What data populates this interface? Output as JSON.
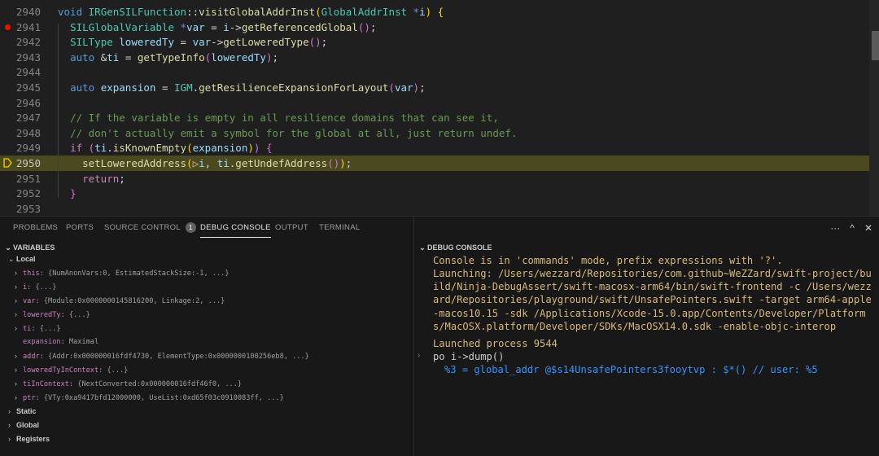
{
  "editor": {
    "lines": [
      {
        "n": "2940",
        "tokens": [
          {
            "c": "kw",
            "t": "void"
          },
          {
            "c": "op",
            "t": " "
          },
          {
            "c": "ty",
            "t": "IRGenSILFunction"
          },
          {
            "c": "op",
            "t": "::"
          },
          {
            "c": "fn",
            "t": "visitGlobalAddrInst"
          },
          {
            "c": "pn",
            "t": "("
          },
          {
            "c": "ty",
            "t": "GlobalAddrInst"
          },
          {
            "c": "op",
            "t": " "
          },
          {
            "c": "kw",
            "t": "*"
          },
          {
            "c": "var",
            "t": "i"
          },
          {
            "c": "pn",
            "t": ")"
          },
          {
            "c": "op",
            "t": " "
          },
          {
            "c": "pn",
            "t": "{"
          }
        ]
      },
      {
        "n": "2941",
        "bp": true,
        "tokens": [
          {
            "c": "op",
            "t": "  "
          },
          {
            "c": "ty",
            "t": "SILGlobalVariable"
          },
          {
            "c": "op",
            "t": " "
          },
          {
            "c": "kw",
            "t": "*"
          },
          {
            "c": "var",
            "t": "var"
          },
          {
            "c": "op",
            "t": " = "
          },
          {
            "c": "var",
            "t": "i"
          },
          {
            "c": "op",
            "t": "->"
          },
          {
            "c": "fn",
            "t": "getReferencedGlobal"
          },
          {
            "c": "pn2",
            "t": "()"
          },
          {
            "c": "op",
            "t": ";"
          }
        ]
      },
      {
        "n": "2942",
        "tokens": [
          {
            "c": "op",
            "t": "  "
          },
          {
            "c": "ty",
            "t": "SILType"
          },
          {
            "c": "op",
            "t": " "
          },
          {
            "c": "var",
            "t": "loweredTy"
          },
          {
            "c": "op",
            "t": " = "
          },
          {
            "c": "var",
            "t": "var"
          },
          {
            "c": "op",
            "t": "->"
          },
          {
            "c": "fn",
            "t": "getLoweredType"
          },
          {
            "c": "pn2",
            "t": "()"
          },
          {
            "c": "op",
            "t": ";"
          }
        ]
      },
      {
        "n": "2943",
        "tokens": [
          {
            "c": "op",
            "t": "  "
          },
          {
            "c": "kw",
            "t": "auto"
          },
          {
            "c": "op",
            "t": " &"
          },
          {
            "c": "var",
            "t": "ti"
          },
          {
            "c": "op",
            "t": " = "
          },
          {
            "c": "fn",
            "t": "getTypeInfo"
          },
          {
            "c": "pn2",
            "t": "("
          },
          {
            "c": "var",
            "t": "loweredTy"
          },
          {
            "c": "pn2",
            "t": ")"
          },
          {
            "c": "op",
            "t": ";"
          }
        ]
      },
      {
        "n": "2944",
        "tokens": []
      },
      {
        "n": "2945",
        "tokens": [
          {
            "c": "op",
            "t": "  "
          },
          {
            "c": "kw",
            "t": "auto"
          },
          {
            "c": "op",
            "t": " "
          },
          {
            "c": "var",
            "t": "expansion"
          },
          {
            "c": "op",
            "t": " = "
          },
          {
            "c": "ty",
            "t": "IGM"
          },
          {
            "c": "op",
            "t": "."
          },
          {
            "c": "fn",
            "t": "getResilienceExpansionForLayout"
          },
          {
            "c": "pn2",
            "t": "("
          },
          {
            "c": "var",
            "t": "var"
          },
          {
            "c": "pn2",
            "t": ")"
          },
          {
            "c": "op",
            "t": ";"
          }
        ]
      },
      {
        "n": "2946",
        "tokens": []
      },
      {
        "n": "2947",
        "tokens": [
          {
            "c": "op",
            "t": "  "
          },
          {
            "c": "cm",
            "t": "// If the variable is empty in all resilience domains that can see it,"
          }
        ]
      },
      {
        "n": "2948",
        "tokens": [
          {
            "c": "op",
            "t": "  "
          },
          {
            "c": "cm",
            "t": "// don't actually emit a symbol for the global at all, just return undef."
          }
        ]
      },
      {
        "n": "2949",
        "tokens": [
          {
            "c": "op",
            "t": "  "
          },
          {
            "c": "kw2",
            "t": "if"
          },
          {
            "c": "op",
            "t": " "
          },
          {
            "c": "pn2",
            "t": "("
          },
          {
            "c": "var",
            "t": "ti"
          },
          {
            "c": "op",
            "t": "."
          },
          {
            "c": "fn",
            "t": "isKnownEmpty"
          },
          {
            "c": "pn",
            "t": "("
          },
          {
            "c": "var",
            "t": "expansion"
          },
          {
            "c": "pn",
            "t": ")"
          },
          {
            "c": "pn2",
            "t": ")"
          },
          {
            "c": "op",
            "t": " "
          },
          {
            "c": "pn2",
            "t": "{"
          }
        ]
      },
      {
        "n": "2950",
        "current": true,
        "tokens": [
          {
            "c": "op",
            "t": "    "
          },
          {
            "c": "fn",
            "t": "setLoweredAddress"
          },
          {
            "c": "pn",
            "t": "("
          },
          {
            "c": "inline-mark",
            "t": "▷"
          },
          {
            "c": "var",
            "t": "i"
          },
          {
            "c": "op",
            "t": ", "
          },
          {
            "c": "var",
            "t": "ti"
          },
          {
            "c": "op",
            "t": "."
          },
          {
            "c": "fn",
            "t": "getUndefAddress"
          },
          {
            "c": "pn2",
            "t": "()"
          },
          {
            "c": "pn",
            "t": ")"
          },
          {
            "c": "op",
            "t": ";"
          }
        ]
      },
      {
        "n": "2951",
        "tokens": [
          {
            "c": "op",
            "t": "    "
          },
          {
            "c": "kw2",
            "t": "return"
          },
          {
            "c": "op",
            "t": ";"
          }
        ]
      },
      {
        "n": "2952",
        "tokens": [
          {
            "c": "op",
            "t": "  "
          },
          {
            "c": "pn2",
            "t": "}"
          }
        ]
      },
      {
        "n": "2953",
        "tokens": []
      }
    ]
  },
  "panel": {
    "tabs": [
      {
        "label": "PROBLEMS"
      },
      {
        "label": "PORTS"
      },
      {
        "label": "SOURCE CONTROL",
        "badge": "1"
      },
      {
        "label": "DEBUG CONSOLE",
        "active": true
      },
      {
        "label": "OUTPUT"
      },
      {
        "label": "TERMINAL"
      }
    ],
    "actions": {
      "more": "···",
      "maximize": "^",
      "close": "✕"
    }
  },
  "variables": {
    "header": "VARIABLES",
    "rows": [
      {
        "kind": "group",
        "open": true,
        "indent": 1,
        "label": "Local"
      },
      {
        "kind": "var",
        "indent": 2,
        "name": "this",
        "value": "{NumAnonVars:0, EstimatedStackSize:-1, ...}"
      },
      {
        "kind": "var",
        "indent": 2,
        "name": "i",
        "value": "{...}"
      },
      {
        "kind": "var",
        "indent": 2,
        "name": "var",
        "value": "{Module:0x0000000145816200, Linkage:2, ...}"
      },
      {
        "kind": "var",
        "indent": 2,
        "name": "loweredTy",
        "value": "{...}"
      },
      {
        "kind": "var",
        "indent": 2,
        "name": "ti",
        "value": "{...}"
      },
      {
        "kind": "leaf",
        "indent": 2,
        "name": "expansion",
        "value": "Maximal"
      },
      {
        "kind": "var",
        "indent": 2,
        "name": "addr",
        "value": "{Addr:0x000000016fdf4730, ElementType:0x0000000100256eb8, ...}"
      },
      {
        "kind": "var",
        "indent": 2,
        "name": "loweredTyInContext",
        "value": "{...}"
      },
      {
        "kind": "var",
        "indent": 2,
        "name": "tiInContext",
        "value": "{NextConverted:0x000000016fdf46f0, ...}"
      },
      {
        "kind": "var",
        "indent": 2,
        "name": "ptr",
        "value": "{VTy:0xa9417bfd12000000, UseList:0xd65f03c0910083ff, ...}"
      },
      {
        "kind": "group",
        "open": false,
        "indent": 1,
        "label": "Static"
      },
      {
        "kind": "group",
        "open": false,
        "indent": 1,
        "label": "Global"
      },
      {
        "kind": "group",
        "open": false,
        "indent": 1,
        "label": "Registers"
      }
    ]
  },
  "console": {
    "header": "DEBUG CONSOLE",
    "lines": [
      {
        "kind": "output",
        "text": "Console is in 'commands' mode, prefix expressions with '?'."
      },
      {
        "kind": "output",
        "text": "Launching: /Users/wezzard/Repositories/com.github~WeZZard/swift-project/build/Ninja-DebugAssert/swift-macosx-arm64/bin/swift-frontend -c /Users/wezzard/Repositories/playground/swift/UnsafePointers.swift -target arm64-apple-macos10.15 -sdk /Applications/Xcode-15.0.app/Contents/Developer/Platforms/MacOSX.platform/Developer/SDKs/MacOSX14.0.sdk -enable-objc-interop"
      },
      {
        "kind": "output",
        "text": "Launched process 9544"
      },
      {
        "kind": "input",
        "text": "po i->dump()"
      },
      {
        "kind": "result",
        "text": "%3 = global_addr @$s14UnsafePointers3fooytvp : $*() // user: %5"
      }
    ]
  }
}
